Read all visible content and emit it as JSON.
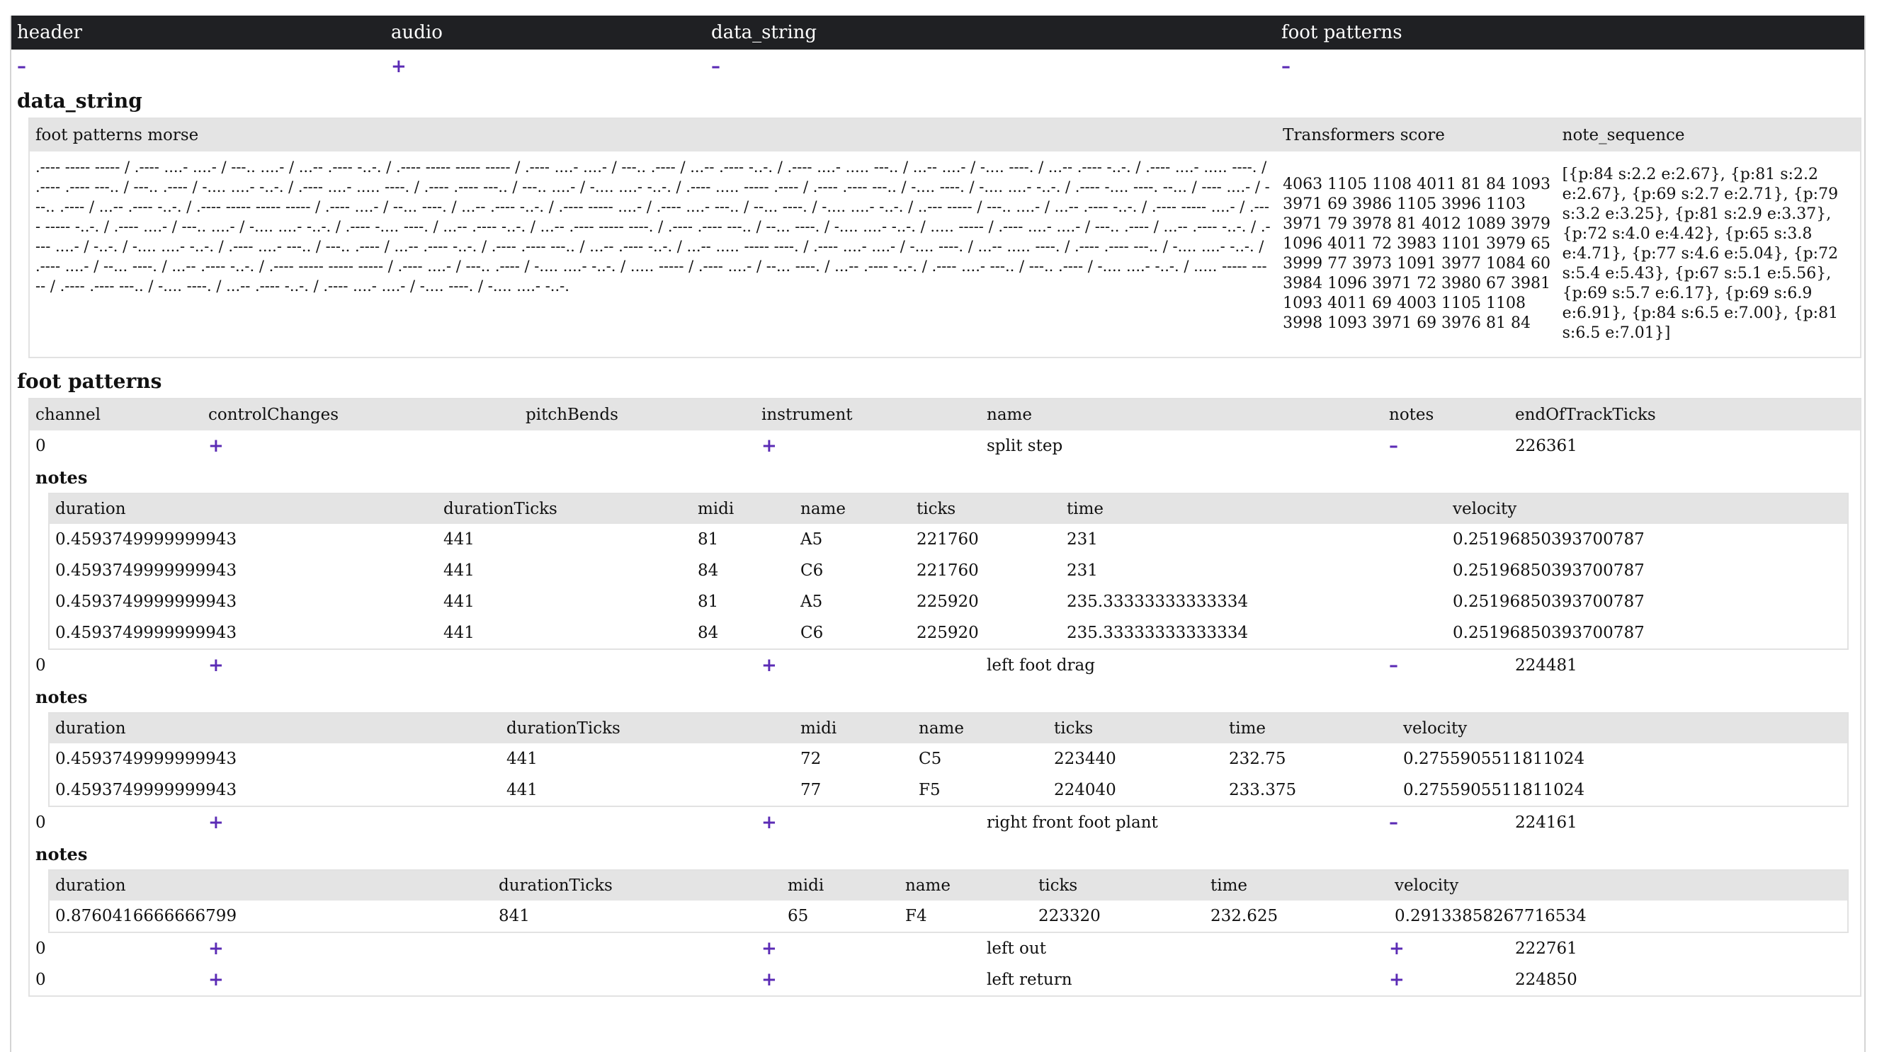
{
  "top": {
    "tabs": [
      "header",
      "audio",
      "data_string",
      "foot patterns"
    ],
    "toggles": [
      "–",
      "+",
      "–",
      "–"
    ]
  },
  "data_string": {
    "title": "data_string",
    "columns": [
      "foot patterns morse",
      "Transformers score",
      "note_sequence"
    ],
    "morse": ".---- ----- ----- / .---- ....- ....- / ---.. ....- / ...-- .---- -..-. / .---- ----- ----- ----- / .---- ....- ....- / ---.. .---- / ...-- .---- -..-. / .---- ....- ..... ---.. / ...-- ....- / -.... ----. / ...-- .---- -..-. / .---- ....- ..... ----. / .---- .---- ---.. / ---.. .---- / -.... ....- -..-. / .---- ....- ..... ----. / .---- .---- ---.. / ---.. ....- / -.... ....- -..-. / .---- ..... ----- .---- / .---- .---- ---.. / -.... ----. / -.... ....- -..-. / .---- -.... ----. --... / ---- ....- / ---.. .---- / ...-- .---- -..-. / .---- ----- ----- ----- / .---- ....- / --... ----. / ...-- .---- -..-. / .---- ----- ....- / .---- ....- ---.. / --... ----. / -.... ....- -..-. / ..--- ----- / ---.. ....- / ...-- .---- -..-. / .---- ----- ....- / .---- ----- -..-. / .---- ....- / ---.. ....- / -.... ....- -..-. / .---- -.... ----. / ...-- .---- -..-. / ...-- .---- ----- ----. / .---- .---- ---.. / --... ----. / -.... ....- -..-. / ..... ----- / .---- ....- ....- / ---.. .---- / ...-- .---- -..-. / .---- ....- / -..-. / -.... ....- -..-. / .---- ....- ---.. / ---.. .---- / ...-- .---- -..-. / .---- .---- ---.. / ...-- .---- -..-. / ...-- ..... ----- ----. / .---- ....- ....- / -.... ----. / ...-- ..... ----. / .---- .---- ---.. / -.... ....- -..-. / .---- ....- / --... ----. / ...-- .---- -..-. / .---- ----- ----- ----- / .---- ....- / ---.. .---- / -.... ....- -..-. / ..... ----- / .---- ....- / --... ----. / ...-- .---- -..-. / .---- ....- ---.. / ---.. .---- / -.... ....- -..-. / ..... ----- ----- / .---- .---- ---.. / -.... ----. / ...-- .---- -..-. / .---- ....- ....- / -.... ----. / -.... ....- -..-.",
    "score": "4063 1105 1108 4011 81 84 1093 3971 69 3986 1105 3996 1103 3971 79 3978 81 4012 1089 3979 1096 4011 72 3983 1101 3979 65 3999 77 3973 1091 3977 1084 60 3984 1096 3971 72 3980 67 3981 1093 4011 69 4003 1105 1108 3998 1093 3971 69 3976 81 84",
    "sequence": "[{p:84 s:2.2 e:2.67}, {p:81 s:2.2 e:2.67}, {p:69 s:2.7 e:2.71}, {p:79 s:3.2 e:3.25}, {p:81 s:2.9 e:3.37}, {p:72 s:4.0 e:4.42}, {p:65 s:3.8 e:4.71}, {p:77 s:4.6 e:5.04}, {p:72 s:5.4 e:5.43}, {p:67 s:5.1 e:5.56}, {p:69 s:5.7 e:6.17}, {p:69 s:6.9 e:6.91}, {p:84 s:6.5 e:7.00}, {p:81 s:6.5 e:7.01}]"
  },
  "foot": {
    "title": "foot patterns",
    "columns": [
      "channel",
      "controlChanges",
      "pitchBends",
      "instrument",
      "name",
      "notes",
      "endOfTrackTicks"
    ],
    "notes_label": "notes",
    "note_columns": [
      "duration",
      "durationTicks",
      "midi",
      "name",
      "ticks",
      "time",
      "velocity"
    ],
    "tracks": [
      {
        "channel": "0",
        "cc": "+",
        "inst": "+",
        "name": "split step",
        "notes": "–",
        "end": "226361",
        "rows": [
          [
            "0.4593749999999943",
            "441",
            "81",
            "A5",
            "221760",
            "231",
            "0.25196850393700787"
          ],
          [
            "0.4593749999999943",
            "441",
            "84",
            "C6",
            "221760",
            "231",
            "0.25196850393700787"
          ],
          [
            "0.4593749999999943",
            "441",
            "81",
            "A5",
            "225920",
            "235.33333333333334",
            "0.25196850393700787"
          ],
          [
            "0.4593749999999943",
            "441",
            "84",
            "C6",
            "225920",
            "235.33333333333334",
            "0.25196850393700787"
          ]
        ]
      },
      {
        "channel": "0",
        "cc": "+",
        "inst": "+",
        "name": "left foot drag",
        "notes": "–",
        "end": "224481",
        "rows": [
          [
            "0.4593749999999943",
            "441",
            "72",
            "C5",
            "223440",
            "232.75",
            "0.2755905511811024"
          ],
          [
            "0.4593749999999943",
            "441",
            "77",
            "F5",
            "224040",
            "233.375",
            "0.2755905511811024"
          ]
        ]
      },
      {
        "channel": "0",
        "cc": "+",
        "inst": "+",
        "name": "right front foot plant",
        "notes": "–",
        "end": "224161",
        "rows": [
          [
            "0.8760416666666799",
            "841",
            "65",
            "F4",
            "223320",
            "232.625",
            "0.29133858267716534"
          ]
        ]
      },
      {
        "channel": "0",
        "cc": "+",
        "inst": "+",
        "name": "left out",
        "notes": "+",
        "end": "222761",
        "rows": []
      },
      {
        "channel": "0",
        "cc": "+",
        "inst": "+",
        "name": "left return",
        "notes": "+",
        "end": "224850",
        "rows": []
      }
    ]
  }
}
